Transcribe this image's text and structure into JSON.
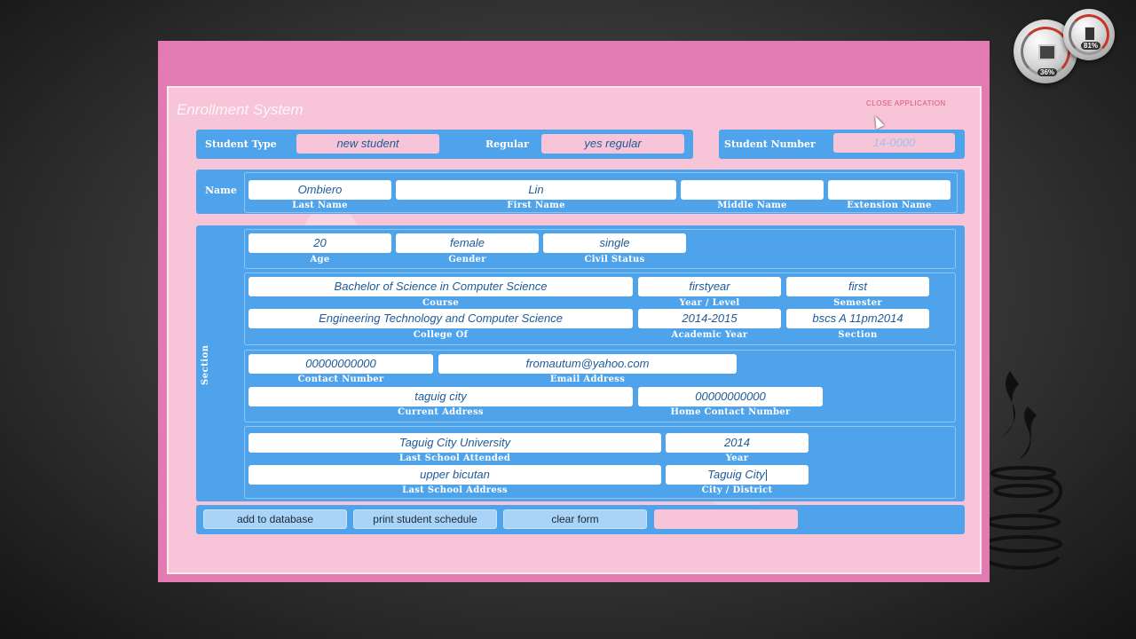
{
  "gadgets": {
    "cpu_pct": "36%",
    "mem_pct": "81%"
  },
  "app": {
    "title": "Enrollment System",
    "close_label": "CLOSE APPLICATION"
  },
  "student": {
    "type_label": "Student Type",
    "type_value": "new student",
    "regular_label": "Regular",
    "regular_value": "yes regular",
    "number_label": "Student Number",
    "number_value": "14-0000"
  },
  "name": {
    "section_label": "Name",
    "last_name": "Ombiero",
    "last_name_label": "Last Name",
    "first_name": "Lin",
    "first_name_label": "First Name",
    "middle_name": "",
    "middle_name_label": "Middle Name",
    "extension_name": "",
    "extension_name_label": "Extension Name"
  },
  "general": {
    "section_label": "Section",
    "age": "20",
    "age_label": "Age",
    "gender": "female",
    "gender_label": "Gender",
    "civil_status": "single",
    "civil_status_label": "Civil Status",
    "course": "Bachelor of Science in Computer Science",
    "course_label": "Course",
    "year_level": "firstyear",
    "year_level_label": "Year / Level",
    "semester": "first",
    "semester_label": "Semester",
    "college": "Engineering Technology and Computer Science",
    "college_label": "College Of",
    "academic_year": "2014-2015",
    "academic_year_label": "Academic Year",
    "section": "bscs A 11pm2014",
    "contact_number": "00000000000",
    "contact_number_label": "Contact Number",
    "email": "fromautum@yahoo.com",
    "email_label": "Email Address",
    "current_address": "taguig city",
    "current_address_label": "Current Address",
    "home_contact": "00000000000",
    "home_contact_label": "Home Contact Number",
    "last_school": "Taguig City University",
    "last_school_label": "Last School Attended",
    "school_year": "2014",
    "school_year_label": "Year",
    "school_address": "upper bicutan",
    "school_address_label": "Last School Address",
    "city": "Taguig City",
    "city_label": "City / District"
  },
  "buttons": {
    "add": "add to database",
    "print": "print student schedule",
    "clear": "clear form",
    "extra": ""
  }
}
